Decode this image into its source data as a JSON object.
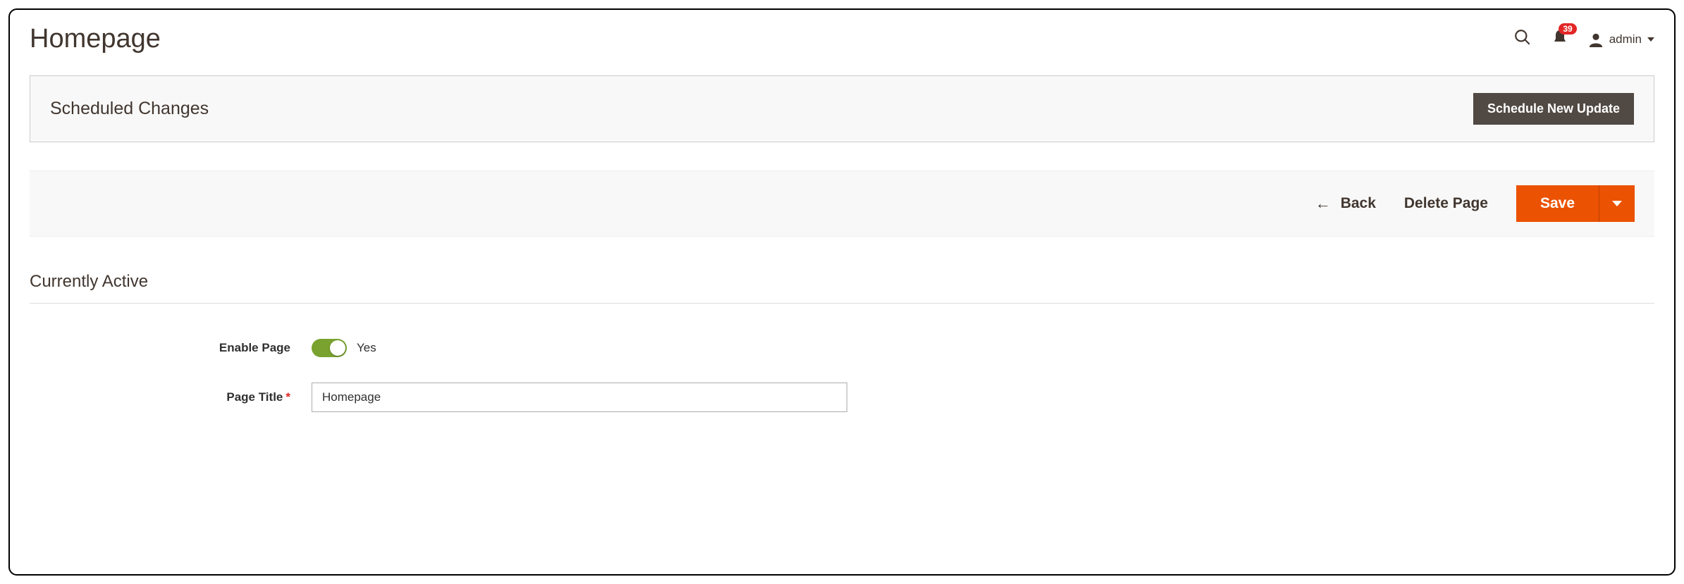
{
  "header": {
    "title": "Homepage",
    "notification_count": "39",
    "user_label": "admin"
  },
  "scheduled": {
    "heading": "Scheduled Changes",
    "new_update_button": "Schedule New Update"
  },
  "actions": {
    "back": "Back",
    "delete": "Delete Page",
    "save": "Save"
  },
  "section": {
    "currently_active": "Currently Active"
  },
  "form": {
    "enable_page_label": "Enable Page",
    "enable_page_value": "Yes",
    "page_title_label": "Page Title",
    "page_title_value": "Homepage"
  }
}
